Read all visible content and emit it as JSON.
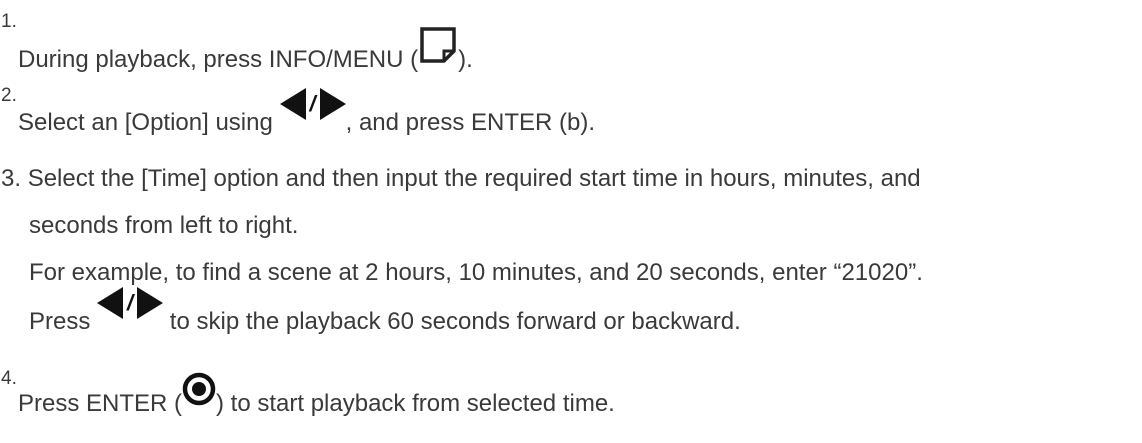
{
  "steps": [
    {
      "num": "1.",
      "pre": "During playback, press INFO/MENU (",
      "post": ")."
    },
    {
      "num": "2.",
      "pre": "Select an [Option] using ",
      "post": ", and press ENTER (b)."
    },
    {
      "num": "3.",
      "line1": "Select the [Time] option and then input the required start time in hours, minutes, and",
      "line2": "seconds from left to right.",
      "line3": "For example, to find a scene at 2 hours, 10 minutes, and 20 seconds, enter “21020”.",
      "press": "Press ",
      "post": " to skip the playback 60 seconds forward or backward."
    },
    {
      "num": "4.",
      "pre": "Press ENTER (",
      "post": ") to start playback from selected time."
    }
  ],
  "icons": [
    "info-menu-icon",
    "left-arrow-icon",
    "slash-separator",
    "right-arrow-icon",
    "enter-circle-icon"
  ]
}
